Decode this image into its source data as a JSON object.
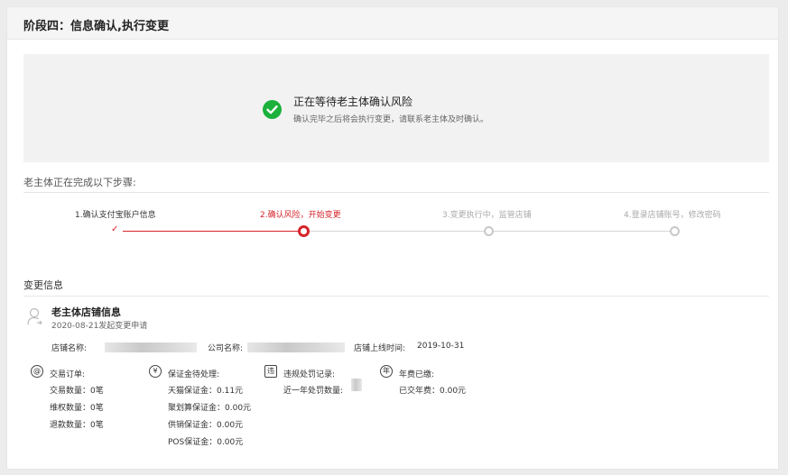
{
  "page": {
    "title": "阶段四：信息确认,执行变更"
  },
  "status": {
    "title": "正在等待老主体确认风险",
    "description": "确认完毕之后将会执行变更，请联系老主体及时确认。",
    "icon": "check-circle-icon",
    "color": "#1bb13c"
  },
  "steps": {
    "heading": "老主体正在完成以下步骤:",
    "items": [
      {
        "label": "1.确认支付宝账户信息",
        "state": "done"
      },
      {
        "label": "2.确认风险，开始变更",
        "state": "active"
      },
      {
        "label": "3.变更执行中，监管店铺",
        "state": "pending"
      },
      {
        "label": "4.登录店铺账号，修改密码",
        "state": "pending"
      }
    ],
    "active_color": "#d6232a"
  },
  "change_info": {
    "title": "变更信息",
    "store_title": "老主体店铺信息",
    "apply_date": "2020-08-21发起变更申请",
    "store_name_label": "店铺名称:",
    "company_name_label": "公司名称:",
    "online_time_label": "店铺上线时间:",
    "online_time_value": "2019-10-31",
    "stats": {
      "orders": {
        "icon": "@",
        "title": "交易订单:",
        "lines": [
          "交易数量：0笔",
          "维权数量：0笔",
          "退款数量：0笔"
        ]
      },
      "deposit": {
        "icon": "¥",
        "title": "保证金待处理:",
        "lines": [
          "天猫保证金：0.11元",
          "聚划算保证金：0.00元",
          "供销保证金：0.00元",
          "POS保证金：0.00元"
        ]
      },
      "violations": {
        "icon": "违",
        "title": "违规处罚记录:",
        "lines": [
          "近一年处罚数量:"
        ]
      },
      "annual_fee": {
        "icon": "年",
        "title": "年费已缴:",
        "lines": [
          "已交年费：0.00元"
        ]
      }
    }
  }
}
